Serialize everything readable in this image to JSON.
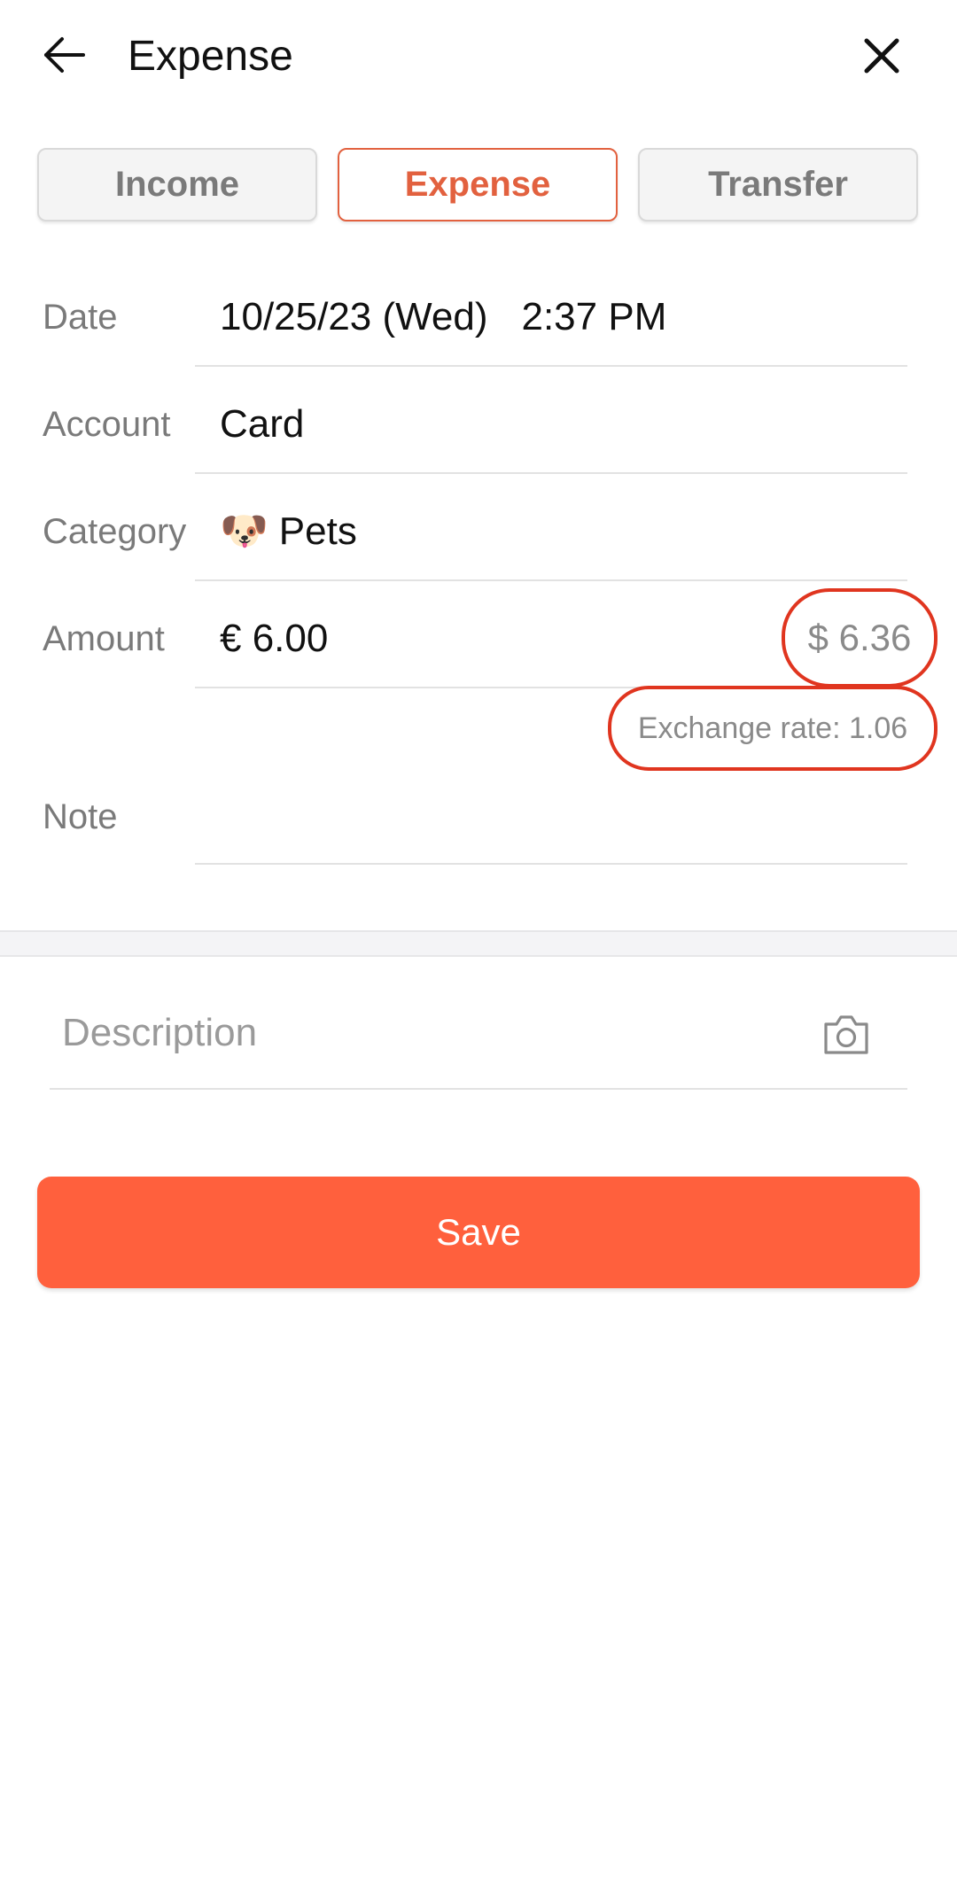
{
  "header": {
    "title": "Expense",
    "back_icon": "arrow-left-icon",
    "close_icon": "close-icon"
  },
  "tabs": [
    {
      "label": "Income",
      "active": false
    },
    {
      "label": "Expense",
      "active": true
    },
    {
      "label": "Transfer",
      "active": false
    }
  ],
  "form": {
    "date": {
      "label": "Date",
      "date": "10/25/23 (Wed)",
      "time": "2:37 PM"
    },
    "account": {
      "label": "Account",
      "value": "Card"
    },
    "category": {
      "label": "Category",
      "emoji": "🐶",
      "value": "Pets"
    },
    "amount": {
      "label": "Amount",
      "value": "€ 6.00",
      "converted": "$ 6.36",
      "exchange_rate": "Exchange rate: 1.06"
    },
    "note": {
      "label": "Note",
      "value": ""
    },
    "description": {
      "placeholder": "Description",
      "camera_icon": "camera-icon"
    }
  },
  "actions": {
    "save_label": "Save"
  },
  "colors": {
    "accent": "#e2613f",
    "save_button": "#ff603d",
    "highlight_ring": "#e0351f"
  }
}
